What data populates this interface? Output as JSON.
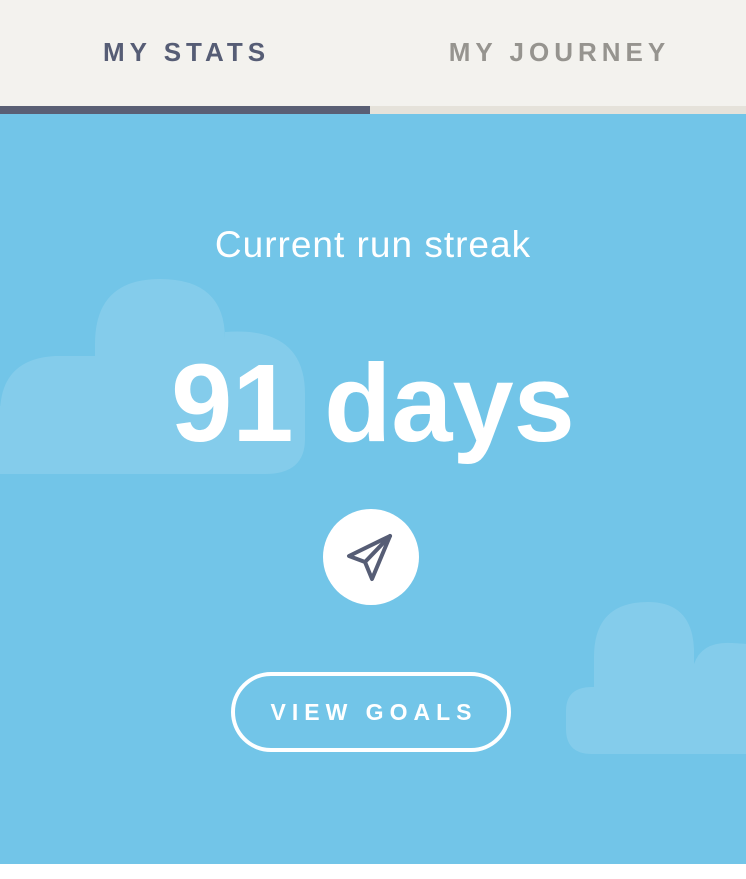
{
  "tabs": {
    "stats": {
      "label": "MY STATS",
      "selected": true
    },
    "journey": {
      "label": "MY JOURNEY",
      "selected": false
    }
  },
  "streak": {
    "label": "Current run streak",
    "value": "91 days"
  },
  "share": {
    "icon": "paper-plane-icon"
  },
  "goals_button": {
    "label": "VIEW GOALS"
  },
  "colors": {
    "panel_background": "#72c5e8",
    "tabbar_background": "#f3f2ee",
    "active_tab": "#565d75",
    "inactive_tab": "#96948f"
  }
}
